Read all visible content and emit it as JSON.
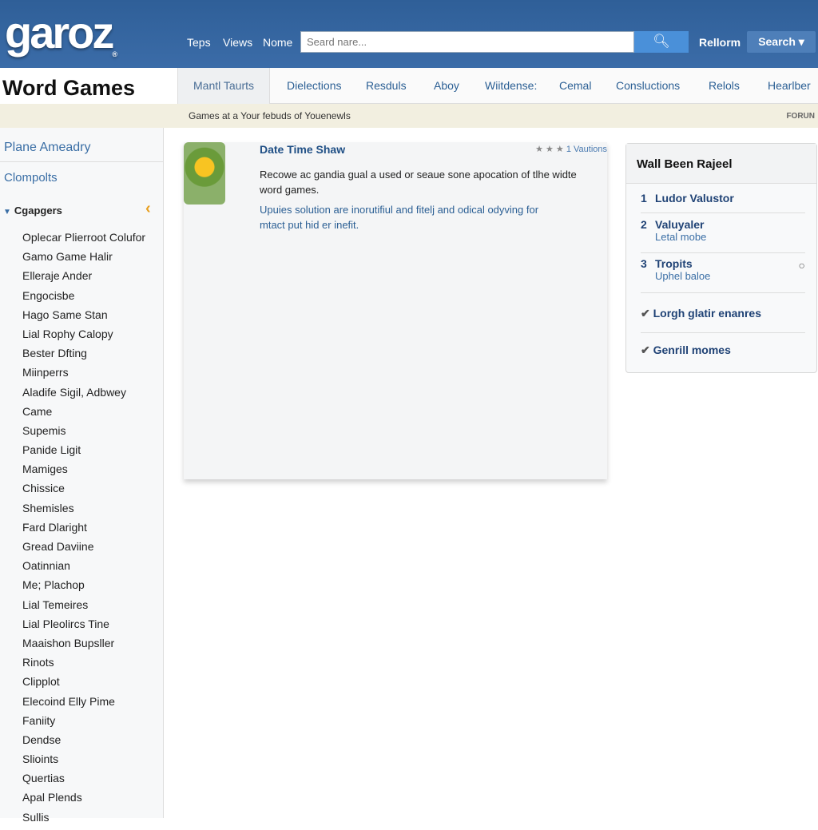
{
  "header": {
    "logo": "garoz",
    "logo_mark": "®",
    "links": [
      "Teps",
      "Views",
      "Nome"
    ],
    "search_placeholder": "Seard nare...",
    "search_icon": "magnifier-icon",
    "reform": "Rellorm",
    "search_button": "Search ▾"
  },
  "nav": {
    "title": "Word Games",
    "tabs": [
      "Mantl Taurts",
      "Dielections",
      "Resduls",
      "Aboy",
      "Wiitdense:",
      "Cemal",
      "Consluctions",
      "Relols",
      "Hearlber"
    ]
  },
  "banner": {
    "text": "Games at a Your febuds of Youenewls",
    "forum": "FORUN"
  },
  "sidebar": {
    "heading1": "Plane Ameadry",
    "heading2": "Clompolts",
    "group": "Cgapgers",
    "items": [
      "Oplecar Plierroot Colufor",
      "Gamo Game Halir",
      "Elleraje Ander",
      "Engocisbe",
      "Hago Same Stan",
      "Lial Rophy Calopy",
      "Bester Dfting",
      "Miinperrs",
      "Aladife Sigil, Adbwey",
      "Came",
      "Supemis",
      "Panide Ligit",
      "Mamiges",
      "Chissice",
      "Shemisles",
      "Fard Dlaright",
      "Gread Daviine",
      "Oatinnian",
      "Me; Plachop",
      "Lial Temeires",
      "Lial Pleolircs Tine",
      "Maaishon Bupsller",
      "Rinots",
      "Clipplot",
      "Elecoind Elly Pime",
      "Faniity",
      "Dendse",
      "Slioints",
      "Quertias",
      "Apal Plends",
      "Sullis"
    ]
  },
  "card": {
    "title": "Date Time Shaw",
    "stars": "★ ★ ★",
    "rating_label": "1 Vautions",
    "description": "Recowe ac gandia gual a used or seaue sone apocation of tlhe widte word games.",
    "description2": "Upuies solution are inorutifiul and fitelj and odical odyving for mtact put hid er inefit."
  },
  "panel": {
    "title": "Wall Been Rajeel",
    "items": [
      {
        "num": "1",
        "label": "Ludor Valustor"
      },
      {
        "num": "2",
        "label": "Valuyaler",
        "sub": "Letal mobe"
      },
      {
        "num": "3",
        "label": "Tropits",
        "sub": "Uphel baloe"
      }
    ],
    "checks": [
      "Lorgh glatir enanres",
      "Genrill momes"
    ]
  }
}
